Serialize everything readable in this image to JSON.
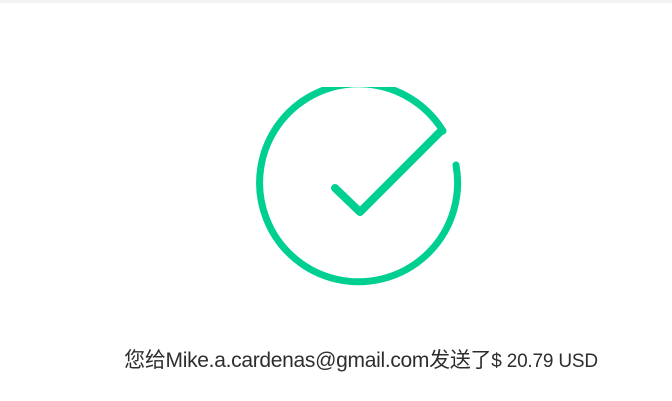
{
  "confirmation": {
    "prefix": "您给",
    "recipient": "Mike.a.cardenas@gmail.com",
    "suffix": "发送了",
    "amount": "$ 20.79 USD"
  },
  "icon": {
    "name": "checkmark-circle-icon",
    "color": "#00cf92"
  }
}
